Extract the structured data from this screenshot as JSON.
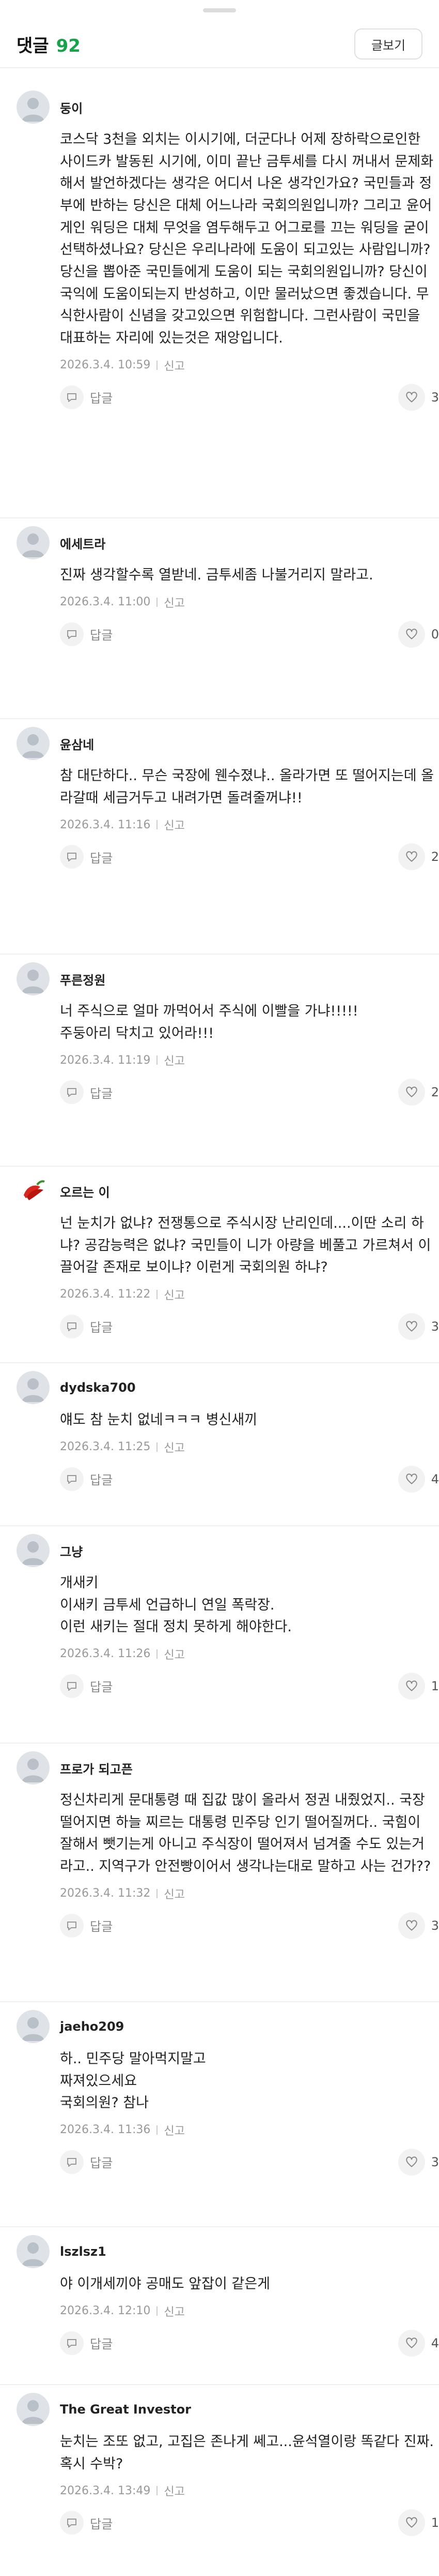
{
  "header": {
    "title": "댓글",
    "count": "92",
    "write_label": "글보기"
  },
  "reply_label": "답글",
  "report_label": "신고",
  "comments": [
    {
      "nick": "둥이",
      "text": "코스닥 3천을 외치는 이시기에, 더군다나 어제 장하락으로인한 사이드카 발동된 시기에, 이미 끝난 금투세를 다시 꺼내서 문제화해서 발언하겠다는 생각은 어디서 나온 생각인가요? 국민들과 정부에 반하는 당신은 대체 어느나라 국회의원입니까? 그리고 윤어게인 워딩은 대체 무엇을 염두해두고 어그로를 끄는 워딩을 굳이 선택하셨나요? 당신은 우리나라에 도움이 되고있는 사람입니까? 당신을 뽑아준 국민들에게 도움이 되는 국회의원입니까? 당신이 국익에 도움이되는지 반성하고, 이만 물러났으면 좋겠습니다. 무식한사람이 신념을 갖고있으면 위험합니다. 그런사람이 국민을 대표하는 자리에 있는것은 재앙입니다.",
      "date": "2026.3.4. 10:59",
      "likes": "3",
      "avatar_color": "#dfe3e8"
    },
    {
      "nick": "에세트라",
      "text": "진짜 생각할수록 열받네. 금투세좀 나불거리지 말라고.",
      "date": "2026.3.4. 11:00",
      "likes": "0",
      "avatar_color": "#dfe3e8"
    },
    {
      "nick": "윤삼네",
      "text": "참 대단하다.. 무슨 국장에 웬수졌냐.. 올라가면 또 떨어지는데 올라갈때 세금거두고 내려가면 돌려줄꺼냐!!",
      "date": "2026.3.4. 11:16",
      "likes": "2",
      "avatar_color": "#dfe3e8"
    },
    {
      "nick": "푸른정원",
      "text": "너 주식으로 얼마 까먹어서 주식에 이빨을 가냐!!!!!\n주둥아리 닥치고 있어라!!!",
      "date": "2026.3.4. 11:19",
      "likes": "2",
      "avatar_color": "#dfe3e8"
    },
    {
      "nick": "오르는 이",
      "text": "넌 눈치가 없냐? 전쟁통으로 주식시장 난리인데....이딴 소리 하냐? 공감능력은 없냐? 국민들이 니가 아량을 베풀고 가르쳐서 이끌어갈 존재로 보이냐? 이런게 국회의원 하냐?",
      "date": "2026.3.4. 11:22",
      "likes": "3",
      "avatar_color": "chili"
    },
    {
      "nick": "dydska700",
      "text": "얘도 참 눈치 없네ㅋㅋㅋ 병신새끼",
      "date": "2026.3.4. 11:25",
      "likes": "4",
      "avatar_color": "#dfe3e8"
    },
    {
      "nick": "그냥",
      "text": "개새키\n이새키 금투세 언급하니 연일 폭락장.\n이런 새키는 절대 정치 못하게 해야한다.",
      "date": "2026.3.4. 11:26",
      "likes": "1",
      "avatar_color": "#dfe3e8"
    },
    {
      "nick": "프로가 되고픈",
      "text": "정신차리게 문대통령 때 집값 많이 올라서 정권 내줬었지.. 국장 떨어지면 하늘 찌르는 대통령 민주당 인기 떨어질꺼다.. 국힘이 잘해서 뺏기는게 아니고 주식장이 떨어져서 넘겨줄 수도 있는거라고.. 지역구가 안전빵이어서 생각나는대로 말하고 사는 건가??",
      "date": "2026.3.4. 11:32",
      "likes": "3",
      "avatar_color": "#dfe3e8"
    },
    {
      "nick": "jaeho209",
      "text": "하.. 민주당 말아먹지말고\n짜져있으세요\n국회의원? 참나",
      "date": "2026.3.4. 11:36",
      "likes": "3",
      "avatar_color": "#dfe3e8"
    },
    {
      "nick": "lszlsz1",
      "text": "야 이개세끼야 공매도 앞잡이 같은게",
      "date": "2026.3.4. 12:10",
      "likes": "4",
      "avatar_color": "#dfe3e8"
    },
    {
      "nick": "The Great Investor",
      "text": "눈치는 조또 없고, 고집은 존나게 쎄고...윤석열이랑 똑같다 진짜. 혹시 수박?",
      "date": "2026.3.4. 13:49",
      "likes": "1",
      "avatar_color": "#dfe3e8"
    }
  ]
}
